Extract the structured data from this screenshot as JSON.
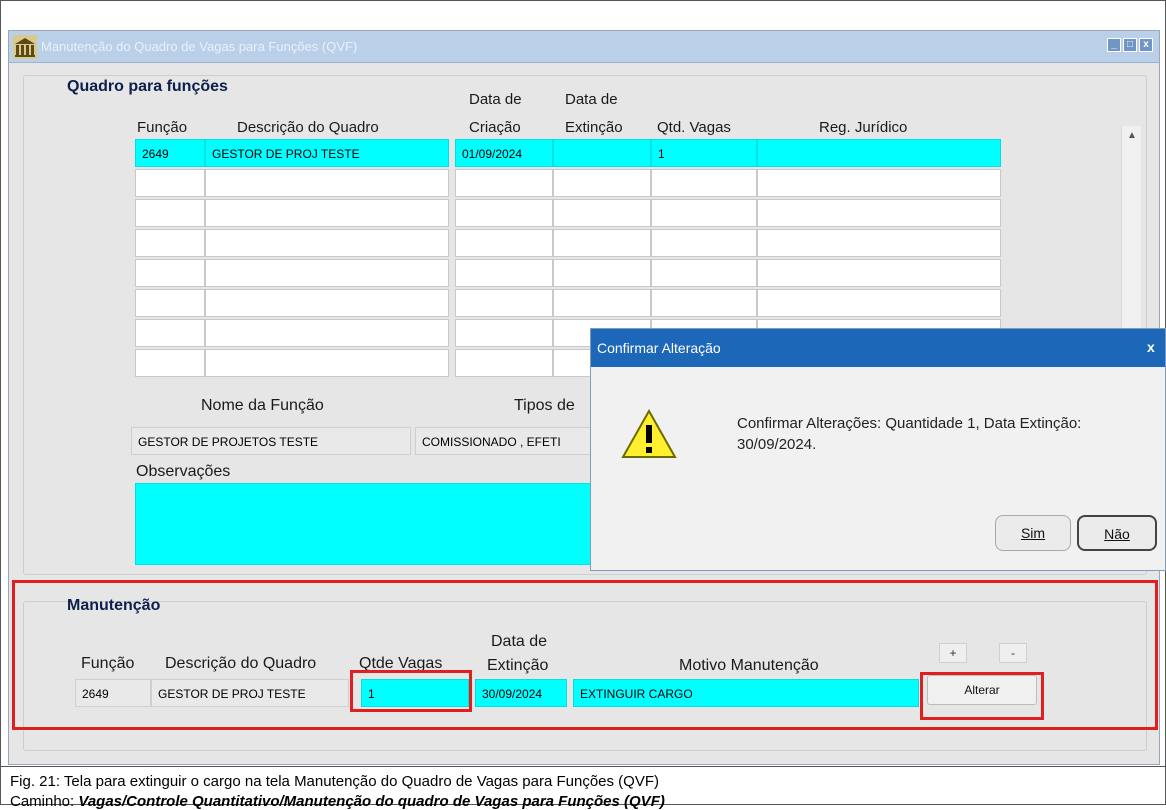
{
  "window": {
    "title": "Manutenção do Quadro de Vagas para Funções (QVF)",
    "buttons": [
      "_",
      "□",
      "x"
    ]
  },
  "quadro": {
    "section_title": "Quadro para funções",
    "headers": {
      "funcao": "Função",
      "descricao": "Descrição do Quadro",
      "data_criacao_1": "Data de",
      "data_criacao_2": "Criação",
      "data_extincao_1": "Data de",
      "data_extincao_2": "Extinção",
      "qtd_vagas": "Qtd. Vagas",
      "reg_juridico": "Reg. Jurídico"
    },
    "rows": [
      {
        "funcao": "2649",
        "descricao": "GESTOR DE PROJ TESTE",
        "data_criacao": "01/09/2024",
        "data_extincao": "",
        "qtd_vagas": "1",
        "reg_juridico": ""
      }
    ],
    "empty_rows": 7
  },
  "detalhes": {
    "nome_funcao_label": "Nome da Função",
    "nome_funcao_value": "GESTOR DE PROJETOS TESTE",
    "tipos_label": "Tipos de",
    "tipos_value": "COMISSIONADO , EFETI",
    "observacoes_label": "Observações",
    "observacoes_value": ""
  },
  "manutencao": {
    "section_title": "Manutenção",
    "headers": {
      "funcao": "Função",
      "descricao": "Descrição do Quadro",
      "qtde_vagas": "Qtde  Vagas",
      "data_extincao_1": "Data de",
      "data_extincao_2": "Extinção",
      "motivo": "Motivo Manutenção"
    },
    "values": {
      "funcao": "2649",
      "descricao": "GESTOR DE PROJ TESTE",
      "qtde_vagas": "1",
      "data_extincao": "30/09/2024",
      "motivo": "EXTINGUIR CARGO"
    },
    "plus_label": "+",
    "minus_label": "-",
    "alterar_label": "Alterar"
  },
  "dialog": {
    "title": "Confirmar Alteração",
    "close": "x",
    "message": "Confirmar Alterações: Quantidade 1, Data Extinção: 30/09/2024.",
    "sim_label": "Sim",
    "nao_label": "Não"
  },
  "caption": {
    "line1": "Fig. 21: Tela para extinguir o cargo na tela Manutenção do Quadro de Vagas para Funções (QVF)",
    "line2_prefix": "Caminho: ",
    "line2_path": "Vagas/Controle Quantitativo/Manutenção do quadro de Vagas para Funções (QVF)"
  },
  "colors": {
    "highlight": "#00ffff",
    "dialog_title": "#1c67b8",
    "annotation": "#e02020"
  }
}
